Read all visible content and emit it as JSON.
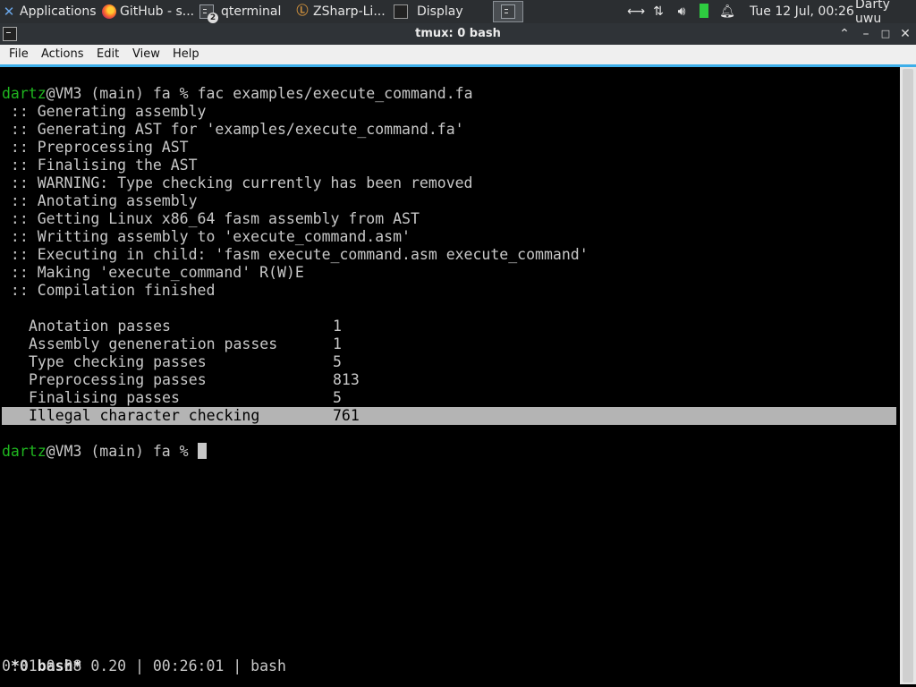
{
  "panel": {
    "tasks": [
      {
        "label": "Applications",
        "icon": "xfce-menu-icon",
        "extra": "☰"
      },
      {
        "label": "GitHub - s...",
        "icon": "firefox-icon"
      },
      {
        "label": "qterminal",
        "icon": "terminal-icon",
        "badge": "2"
      },
      {
        "label": "ZSharp-Li...",
        "icon": "zsharp-icon"
      },
      {
        "label": "Display",
        "icon": "display-icon"
      }
    ],
    "datetime": "Tue 12 Jul, 00:26",
    "user": "Darty uwu"
  },
  "window": {
    "title": "tmux: 0 bash",
    "menu": [
      "File",
      "Actions",
      "Edit",
      "View",
      "Help"
    ]
  },
  "terminal": {
    "prompt_user": "dartz",
    "prompt_rest": "@VM3 (main) fa % ",
    "command": "fac examples/execute_command.fa",
    "output": [
      " :: Generating assembly",
      " :: Generating AST for 'examples/execute_command.fa'",
      " :: Preprocessing AST",
      " :: Finalising the AST",
      " :: WARNING: Type checking currently has been removed",
      " :: Anotating assembly",
      " :: Getting Linux x86_64 fasm assembly from AST",
      " :: Writting assembly to 'execute_command.asm'",
      " :: Executing in child: 'fasm execute_command.asm execute_command'",
      " :: Making 'execute_command' R(W)E",
      " :: Compilation finished"
    ],
    "stats": [
      {
        "name": "Anotation passes",
        "value": "1"
      },
      {
        "name": "Assembly geneneration passes",
        "value": "1"
      },
      {
        "name": "Type checking passes",
        "value": "5"
      },
      {
        "name": "Preprocessing passes",
        "value": "813"
      },
      {
        "name": "Finalising passes",
        "value": "5"
      },
      {
        "name": "Illegal character checking",
        "value": "761"
      }
    ],
    "status_left": "*0 bash*",
    "status_right": "0.01 0.08 0.20 | 00:26:01 | bash"
  }
}
